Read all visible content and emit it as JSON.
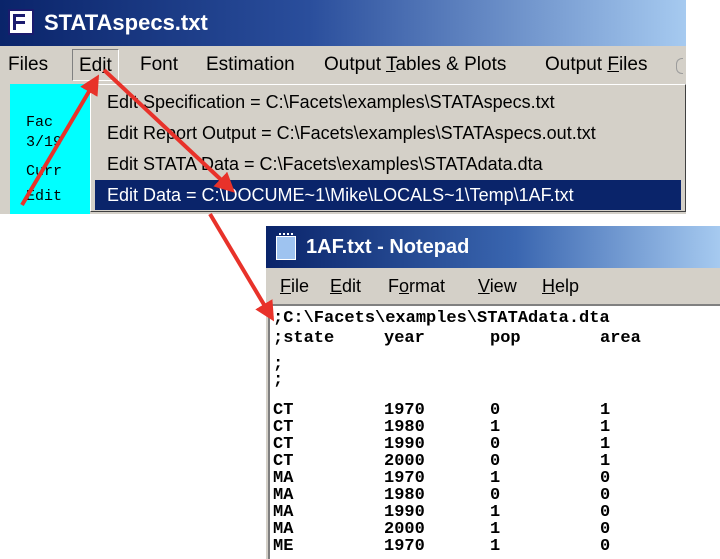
{
  "main_window": {
    "title": "STATAspecs.txt",
    "menu": [
      {
        "pre": "Files",
        "u": "",
        "post": ""
      },
      {
        "pre": "Ed",
        "u": "i",
        "post": "t"
      },
      {
        "pre": "Font",
        "u": "",
        "post": ""
      },
      {
        "pre": "Estimation",
        "u": "",
        "post": ""
      },
      {
        "pre": "Output ",
        "u": "T",
        "post": "ables & Plots"
      },
      {
        "pre": "Output ",
        "u": "F",
        "post": "iles"
      }
    ],
    "side_lines": [
      "Fac",
      "3/19",
      "Curr",
      "Edit"
    ],
    "edit_dropdown": [
      "Edit Specification = C:\\Facets\\examples\\STATAspecs.txt",
      "Edit Report Output = C:\\Facets\\examples\\STATAspecs.out.txt",
      "Edit STATA Data = C:\\Facets\\examples\\STATAdata.dta",
      "Edit Data = C:\\DOCUME~1\\Mike\\LOCALS~1\\Temp\\1AF.txt"
    ],
    "selected_index": 3
  },
  "notepad": {
    "title": "1AF.txt - Notepad",
    "menu": [
      {
        "u": "F",
        "post": "ile"
      },
      {
        "u": "E",
        "post": "dit"
      },
      {
        "pre": "F",
        "u": "o",
        "post": "rmat"
      },
      {
        "u": "V",
        "post": "iew"
      },
      {
        "u": "H",
        "post": "elp"
      }
    ],
    "header_lines": [
      ";C:\\Facets\\examples\\STATAdata.dta",
      ";state",
      ";",
      ";"
    ],
    "columns": [
      "year",
      "pop",
      "area"
    ],
    "rows": [
      [
        "CT",
        "1970",
        "0",
        "1"
      ],
      [
        "CT",
        "1980",
        "1",
        "1"
      ],
      [
        "CT",
        "1990",
        "0",
        "1"
      ],
      [
        "CT",
        "2000",
        "0",
        "1"
      ],
      [
        "MA",
        "1970",
        "1",
        "0"
      ],
      [
        "MA",
        "1980",
        "0",
        "0"
      ],
      [
        "MA",
        "1990",
        "1",
        "0"
      ],
      [
        "MA",
        "2000",
        "1",
        "0"
      ],
      [
        "ME",
        "1970",
        "1",
        "0"
      ]
    ]
  },
  "colors": {
    "arrow": "#e8322a",
    "selection": "#0a246a",
    "panel": "#00ffff"
  }
}
